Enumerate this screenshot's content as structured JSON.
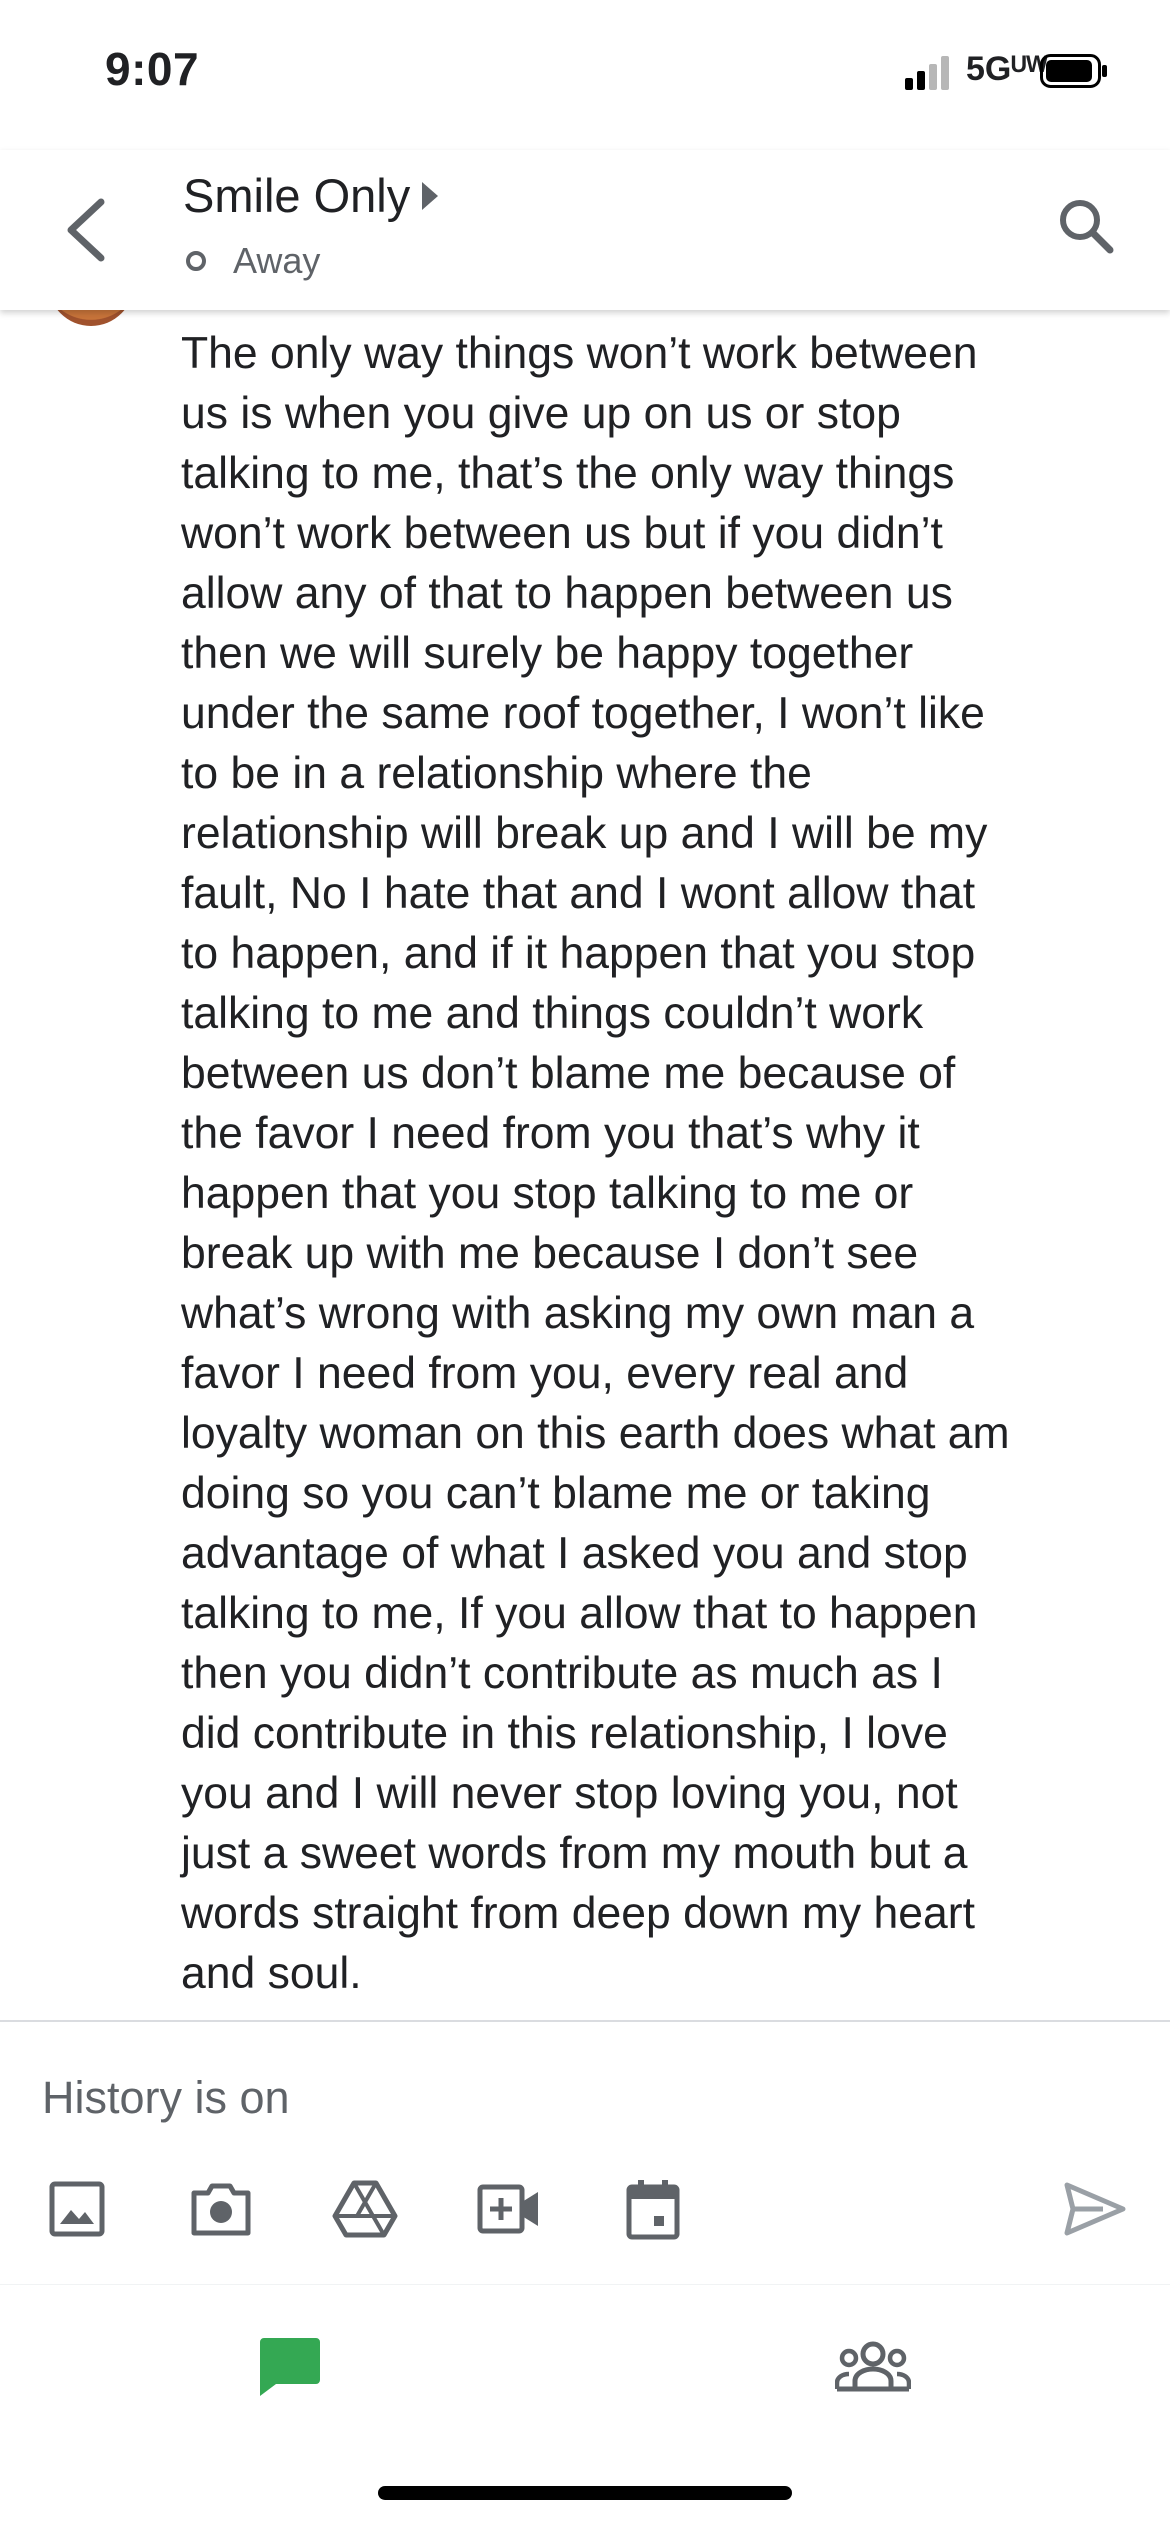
{
  "status_bar": {
    "time": "9:07",
    "network": "5Gᵁᵂ"
  },
  "header": {
    "back_icon": "back-arrow-icon",
    "contact_name": "Smile Only",
    "presence": "Away",
    "search_icon": "search-icon"
  },
  "message": {
    "text": "The only way things won’t work between\nus is when you give up on us or stop\ntalking to me, that’s the only way things\nwon’t work between us but if you didn’t\nallow any of that to happen between us\nthen we will surely be happy together\nunder the same roof together, I won’t like\nto be in a relationship where the\nrelationship will break up and I will be my\nfault, No I hate that and I wont allow that\nto happen, and if it happen that you stop\ntalking to me and things couldn’t work\nbetween us don’t blame me because of\nthe favor I need from you that’s why it\nhappen that you stop talking to me or\nbreak up with me because I don’t see\nwhat’s wrong with asking my own man a\nfavor I need from you, every real and\nloyalty woman on this earth does what am\ndoing so you can’t blame me or taking\nadvantage of what I asked you and stop\ntalking to me, If you allow that to happen\nthen you didn’t contribute as much as I\ndid contribute in this relationship, I love\nyou and I will never stop loving you, not\njust a sweet words from my mouth but a\nwords straight from deep down my heart\nand soul."
  },
  "composer": {
    "placeholder": "History is on",
    "tools": [
      "image-icon",
      "camera-icon",
      "drive-icon",
      "video-call-icon",
      "calendar-icon"
    ],
    "send_icon": "send-icon"
  },
  "bottom_nav": {
    "items": [
      "chat-icon",
      "rooms-icon"
    ],
    "active_color": "#34a853"
  },
  "colors": {
    "text_primary": "#202124",
    "text_secondary": "#5f6368",
    "icon": "#5f6368",
    "chat_active": "#34a853"
  }
}
